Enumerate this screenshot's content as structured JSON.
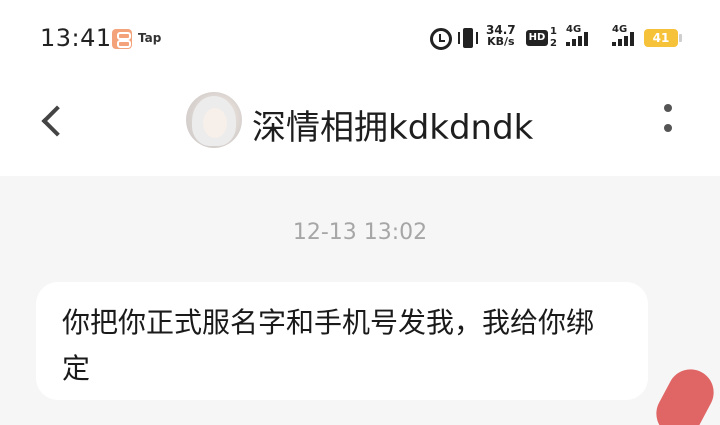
{
  "status_bar": {
    "time": "13:41",
    "app_badge": "Tap",
    "network_speed_value": "34.7",
    "network_speed_unit": "KB/s",
    "hd_label": "HD",
    "sim_index": "1 2",
    "network_type_1": "4G",
    "network_type_2": "4G",
    "battery_level": "41",
    "icons": [
      "alarm-icon",
      "vibrate-icon",
      "signal-icon",
      "battery-icon"
    ]
  },
  "header": {
    "contact_name": "深情相拥kdkdndk",
    "back_icon": "chevron-left-icon",
    "more_icon": "more-vertical-icon"
  },
  "chat": {
    "timestamp": "12-13 13:02",
    "messages": [
      {
        "direction": "incoming",
        "text": "你把你正式服名字和手机号发我，我给你绑定"
      }
    ]
  },
  "colors": {
    "background": "#f6f6f6",
    "bubble": "#ffffff",
    "battery": "#f6c23a",
    "accent": "#e06666"
  }
}
